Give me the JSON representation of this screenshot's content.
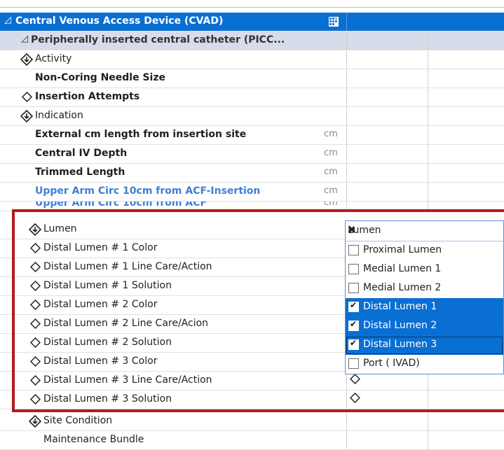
{
  "header": {
    "title": "Central Venous Access Device (CVAD)"
  },
  "section": {
    "title": "Peripherally inserted central catheter (PICC..."
  },
  "rows": [
    {
      "label": "Activity"
    },
    {
      "label": "Non-Coring Needle Size"
    },
    {
      "label": "Insertion Attempts"
    },
    {
      "label": "Indication"
    },
    {
      "label": "External cm length from insertion site",
      "unit": "cm"
    },
    {
      "label": "Central IV Depth",
      "unit": "cm"
    },
    {
      "label": "Trimmed Length",
      "unit": "cm"
    },
    {
      "label": "Upper Arm Circ 10cm from ACF-Insertion",
      "unit": "cm"
    },
    {
      "label": "Upper Arm Circ 10cm from ACF",
      "unit": "cm"
    },
    {
      "label": "Lumen"
    },
    {
      "label": "Distal Lumen # 1 Color"
    },
    {
      "label": "Distal Lumen # 1 Line Care/Action"
    },
    {
      "label": "Distal Lumen # 1 Solution"
    },
    {
      "label": "Distal Lumen # 2 Color"
    },
    {
      "label": "Distal Lumen # 2 Line Care/Acion"
    },
    {
      "label": "Distal Lumen # 2 Solution"
    },
    {
      "label": "Distal Lumen # 3 Color"
    },
    {
      "label": "Distal Lumen # 3 Line Care/Action"
    },
    {
      "label": "Distal Lumen # 3 Solution"
    },
    {
      "label": "Site Condition"
    },
    {
      "label": "Maintenance Bundle"
    }
  ],
  "popup": {
    "title": "Lumen",
    "close": "✖",
    "options": [
      {
        "label": "Proximal Lumen",
        "checked": false
      },
      {
        "label": "Medial Lumen 1",
        "checked": false
      },
      {
        "label": "Medial Lumen 2",
        "checked": false
      },
      {
        "label": "Distal Lumen 1",
        "checked": true
      },
      {
        "label": "Distal Lumen 2",
        "checked": true
      },
      {
        "label": "Distal Lumen 3",
        "checked": true
      },
      {
        "label": "Port ( IVAD)",
        "checked": false
      }
    ]
  },
  "colors": {
    "header": "#0a6fd3",
    "section": "#d7dcea",
    "highlight": "#b21d1d",
    "link": "#3f7fd6"
  }
}
